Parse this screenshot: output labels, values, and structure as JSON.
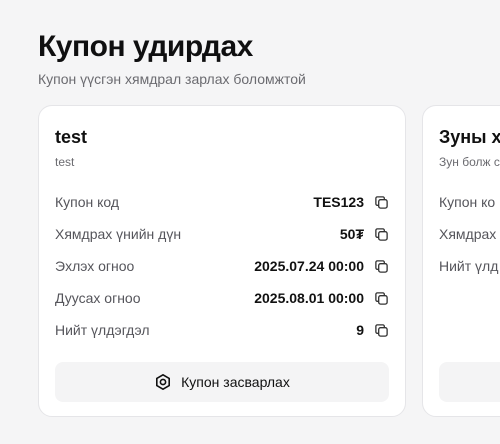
{
  "header": {
    "title": "Купон удирдах",
    "subtitle": "Купон үүсгэн хямдрал зарлах боломжтой"
  },
  "coupons": [
    {
      "name": "test",
      "description": "test",
      "fields": [
        {
          "label": "Купон код",
          "value": "TES123"
        },
        {
          "label": "Хямдрах үнийн дүн",
          "value": "50₮"
        },
        {
          "label": "Эхлэх огноо",
          "value": "2025.07.24 00:00"
        },
        {
          "label": "Дуусах огноо",
          "value": "2025.08.01 00:00"
        },
        {
          "label": "Нийт үлдэгдэл",
          "value": "9"
        }
      ],
      "edit_label": "Купон засварлах"
    },
    {
      "name": "Зуны х",
      "description": "Зун болж с",
      "fields": [
        {
          "label": "Купон ко"
        },
        {
          "label": "Хямдрах"
        },
        {
          "label": "Нийт үлд"
        }
      ]
    }
  ],
  "icons": {
    "copy": "copy-icon",
    "edit": "hexagon-nut-icon"
  }
}
